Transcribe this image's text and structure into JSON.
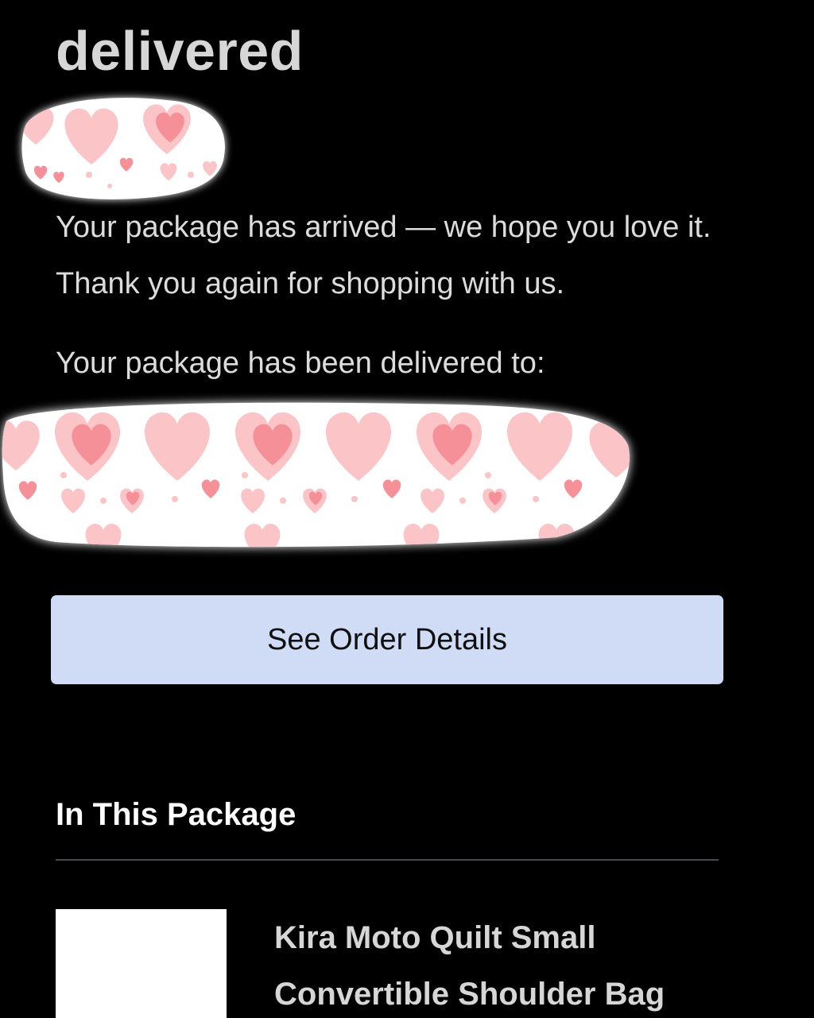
{
  "email": {
    "headline": "delivered",
    "intro_text": "Your package has arrived — we hope you love it. Thank you again for shopping with us.",
    "delivered_to_label": "Your package has been delivered to:",
    "button_label": "See Order Details",
    "section_title": "In This Package",
    "product": {
      "name": "Kira Moto Quilt Small Convertible Shoulder Bag"
    }
  },
  "colors": {
    "background": "#000000",
    "button_background": "#d0dcf6",
    "heart_light": "#fbc4c7",
    "heart_dark": "#f58f98"
  }
}
